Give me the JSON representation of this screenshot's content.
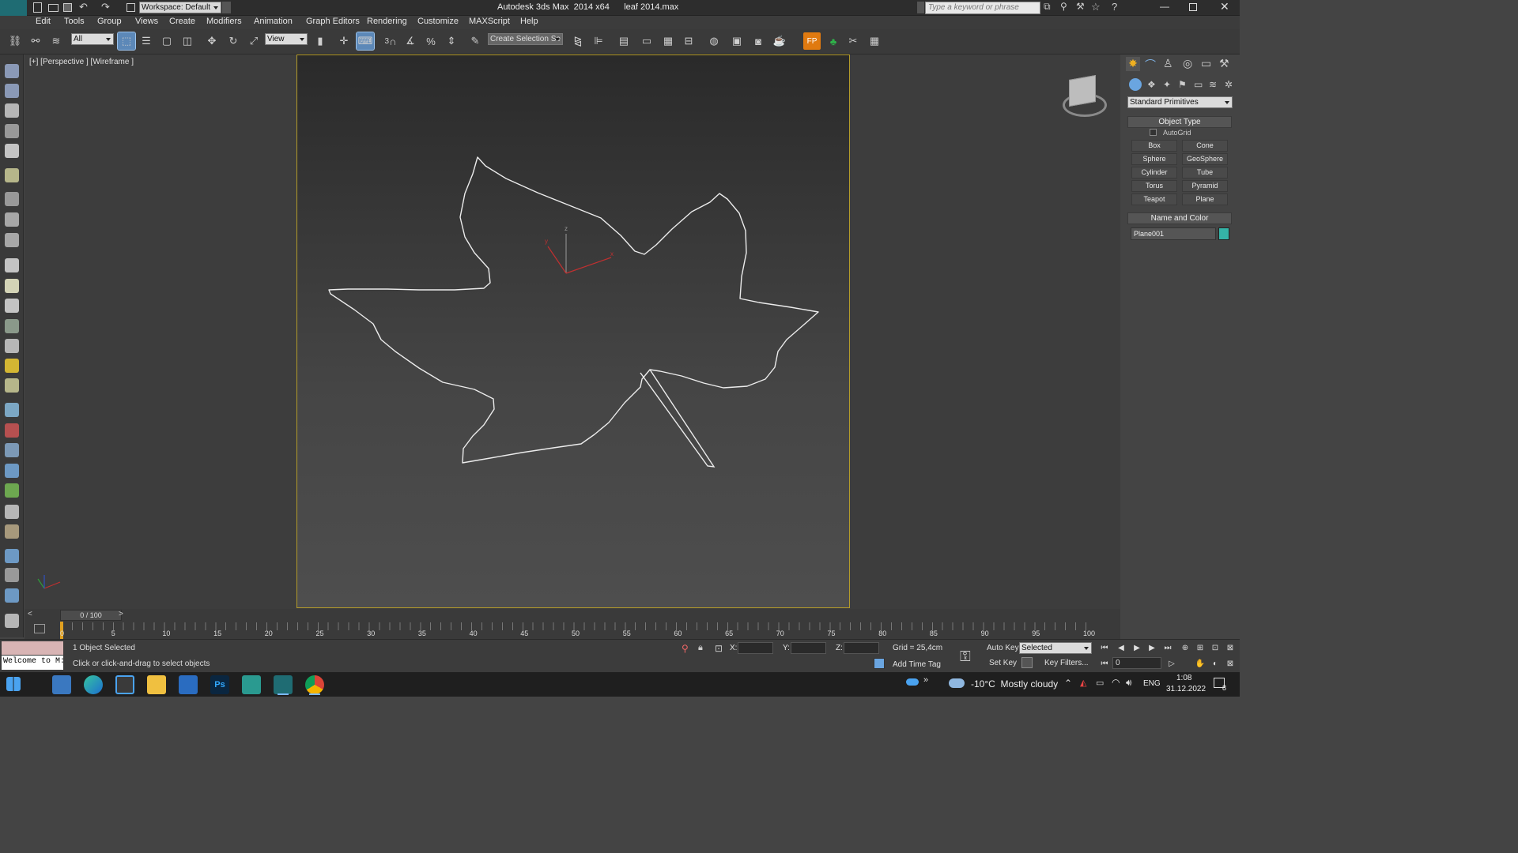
{
  "titlebar": {
    "workspace": "Workspace: Default",
    "title": "Autodesk 3ds Max  2014 x64      leaf 2014.max",
    "search_placeholder": "Type a keyword or phrase"
  },
  "menu": [
    "Edit",
    "Tools",
    "Group",
    "Views",
    "Create",
    "Modifiers",
    "Animation",
    "Graph Editors",
    "Rendering",
    "Customize",
    "MAXScript",
    "Help"
  ],
  "toolbar": {
    "filter_value": "All",
    "refcoord_value": "View",
    "selection_set_placeholder": "Create Selection Se",
    "snap_labels": {
      "snap3": "3",
      "percent": "%"
    }
  },
  "viewport": {
    "label": "[+] [Perspective ] [Wireframe ]",
    "gizmo_axes": {
      "x": "x",
      "y": "y",
      "z": "z"
    }
  },
  "cmdpanel": {
    "category_value": "Standard Primitives",
    "object_type_title": "Object Type",
    "autogrid": "AutoGrid",
    "buttons": [
      "Box",
      "Cone",
      "Sphere",
      "GeoSphere",
      "Cylinder",
      "Tube",
      "Torus",
      "Pyramid",
      "Teapot",
      "Plane"
    ],
    "name_color_title": "Name and Color",
    "object_name": "Plane001",
    "object_color": "#35b3a7"
  },
  "timeline": {
    "frame_counter": "0 / 100",
    "ticks": [
      "0",
      "5",
      "10",
      "15",
      "20",
      "25",
      "30",
      "35",
      "40",
      "45",
      "50",
      "55",
      "60",
      "65",
      "70",
      "75",
      "80",
      "85",
      "90",
      "95",
      "100"
    ]
  },
  "status": {
    "listener": "Welcome to M:",
    "selected": "1 Object Selected",
    "prompt": "Click or click-and-drag to select objects",
    "x_label": "X:",
    "y_label": "Y:",
    "z_label": "Z:",
    "grid": "Grid = 25,4cm",
    "add_time_tag": "Add Time Tag",
    "auto_key": "Auto Key",
    "set_key": "Set Key",
    "key_mode_value": "Selected",
    "key_filters": "Key Filters...",
    "frame_value": "0"
  },
  "taskbar": {
    "weather": "-10°C  Mostly cloudy",
    "lang": "ENG",
    "time": "1:08",
    "date": "31.12.2022",
    "notif_count": "8"
  },
  "colors": {
    "selection_highlight": "#5c88b8",
    "safe_frame": "#b39b2a",
    "gizmo_red": "#c03030"
  }
}
